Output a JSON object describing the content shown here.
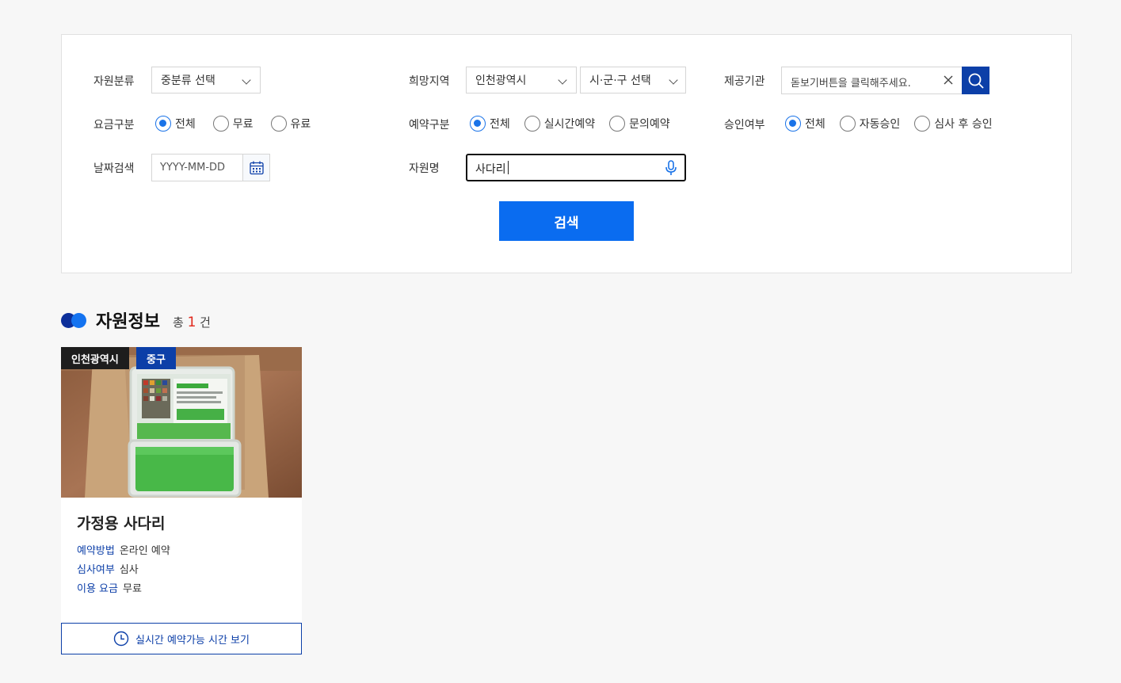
{
  "filters": {
    "resource_type": {
      "label": "자원분류",
      "value": "중분류 선택"
    },
    "region": {
      "label": "희망지역",
      "value": "인천광역시",
      "sub_value": "시·군·구 선택"
    },
    "provider": {
      "label": "제공기관",
      "placeholder": "돋보기버튼을 클릭해주세요."
    },
    "fee": {
      "label": "요금구분",
      "options": [
        "전체",
        "무료",
        "유료"
      ],
      "selected": "전체"
    },
    "reservation": {
      "label": "예약구분",
      "options": [
        "전체",
        "실시간예약",
        "문의예약"
      ],
      "selected": "전체"
    },
    "approval": {
      "label": "승인여부",
      "options": [
        "전체",
        "자동승인",
        "심사 후 승인"
      ],
      "selected": "전체"
    },
    "date": {
      "label": "날짜검색",
      "placeholder": "YYYY-MM-DD"
    },
    "resource_name": {
      "label": "자원명",
      "value": "사다리"
    },
    "search_label": "검색"
  },
  "results": {
    "title": "자원정보",
    "count_prefix": "총",
    "count": "1",
    "count_suffix": "건"
  },
  "cards": [
    {
      "region_tag": "인천광역시",
      "district_tag": "중구",
      "title": "가정용 사다리",
      "info": [
        {
          "key": "예약방법",
          "value": "온라인 예약"
        },
        {
          "key": "심사여부",
          "value": "심사"
        },
        {
          "key": "이용 요금",
          "value": "무료"
        }
      ],
      "time_button": "실시간 예약가능 시간 보기"
    }
  ],
  "colors": {
    "primary": "#0a6cf0",
    "navy": "#0c3fa8",
    "accent_red": "#e0261a"
  }
}
